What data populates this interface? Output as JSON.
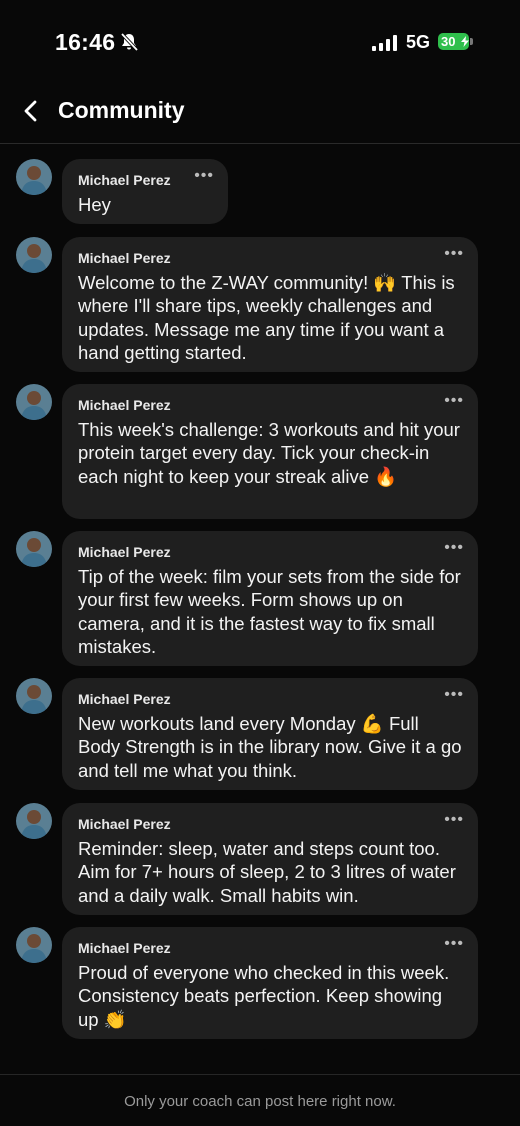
{
  "status_bar": {
    "time": "16:46",
    "network": "5G",
    "battery": "30"
  },
  "header": {
    "title": "Community"
  },
  "messages": [
    {
      "sender": "Michael Perez",
      "text": "Hey"
    },
    {
      "sender": "Michael Perez",
      "text": "Welcome to the Z-WAY community! 🙌 This is where I'll share tips, weekly challenges and updates. Message me any time if you want a hand getting started."
    },
    {
      "sender": "Michael Perez",
      "text": "This week's challenge: 3 workouts and hit your protein target every day. Tick your check-in each night to keep your streak alive 🔥"
    },
    {
      "sender": "Michael Perez",
      "text": "Tip of the week: film your sets from the side for your first few weeks. Form shows up on camera, and it is the fastest way to fix small mistakes."
    },
    {
      "sender": "Michael Perez",
      "text": "New workouts land every Monday 💪 Full Body Strength is in the library now. Give it a go and tell me what you think."
    },
    {
      "sender": "Michael Perez",
      "text": "Reminder: sleep, water and steps count too. Aim for 7+ hours of sleep, 2 to 3 litres of water and a daily walk. Small habits win."
    },
    {
      "sender": "Michael Perez",
      "text": "Proud of everyone who checked in this week. Consistency beats perfection. Keep showing up 👏"
    }
  ],
  "more_label": "•••",
  "footer": {
    "notice": "Only your coach can post here right now."
  },
  "colors": {
    "background": "#080808",
    "bubble": "#1f1f1f",
    "battery": "#2fbf4c"
  }
}
